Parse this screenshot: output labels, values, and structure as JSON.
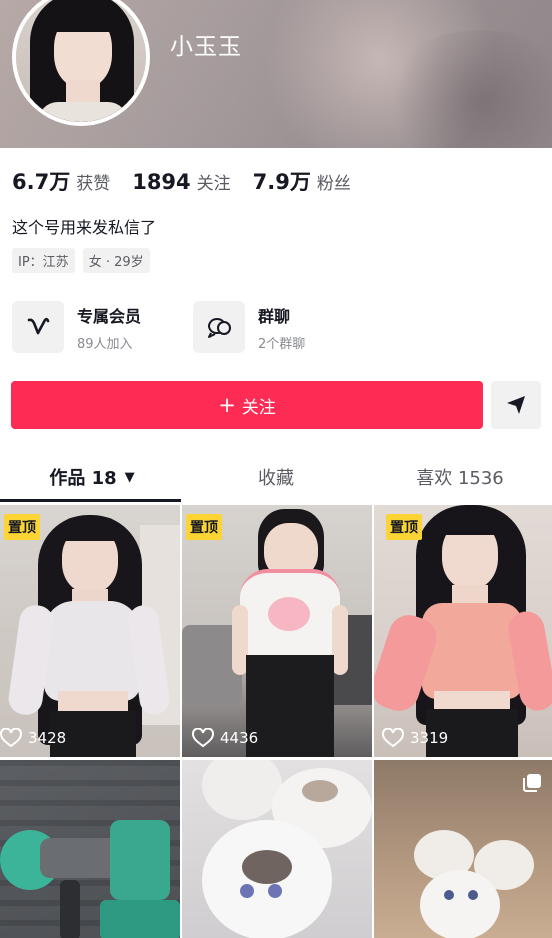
{
  "profile": {
    "username": "小玉玉",
    "bio": "这个号用来发私信了",
    "tags": [
      "IP：江苏",
      "女 · 29岁"
    ]
  },
  "stats": [
    {
      "value": "6.7万",
      "label": "获赞"
    },
    {
      "value": "1894",
      "label": "关注"
    },
    {
      "value": "7.9万",
      "label": "粉丝"
    }
  ],
  "features": [
    {
      "title": "专属会员",
      "subtitle": "89人加入",
      "icon": "v-member-icon"
    },
    {
      "title": "群聊",
      "subtitle": "2个群聊",
      "icon": "group-chat-icon"
    }
  ],
  "actions": {
    "follow_plus": "+",
    "follow_label": "关注",
    "share_icon": "send-arrow-icon"
  },
  "tabs": [
    {
      "label": "作品 18",
      "active": true
    },
    {
      "label": "收藏",
      "active": false
    },
    {
      "label": "喜欢 1536",
      "active": false
    }
  ],
  "videos": [
    {
      "pinned": "置顶",
      "likes": "3428"
    },
    {
      "pinned": "置顶",
      "likes": "4436"
    },
    {
      "pinned": "置顶",
      "likes": "3319"
    },
    {
      "pinned": "",
      "likes": ""
    },
    {
      "pinned": "",
      "likes": ""
    },
    {
      "pinned": "",
      "likes": "",
      "multi_image": true
    }
  ],
  "colors": {
    "accent": "#fe2c55",
    "pin_badge": "#fcd535",
    "text_primary": "#161823",
    "text_secondary": "#5b5c63"
  }
}
